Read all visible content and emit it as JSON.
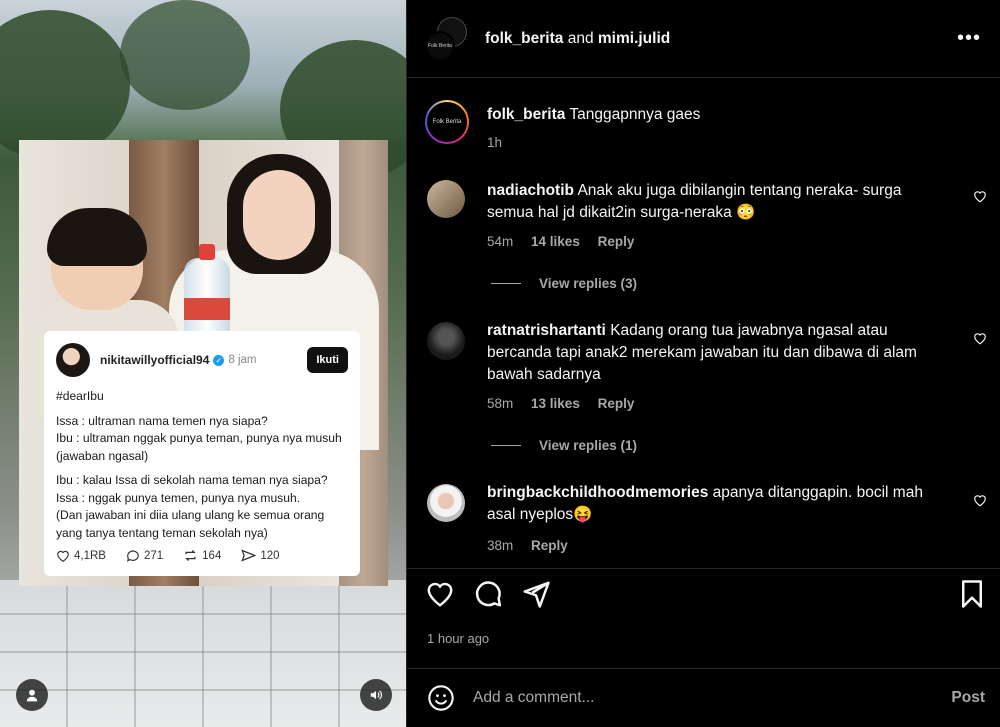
{
  "header": {
    "user1": "folk_berita",
    "joiner": "and",
    "user2": "mimi.julid",
    "avatar2_text": "Folk Berita",
    "more_icon": "more-horizontal-icon"
  },
  "caption": {
    "username": "folk_berita",
    "text": "Tanggapnnya gaes",
    "time": "1h",
    "avatar_text": "Folk Berita"
  },
  "comments": [
    {
      "username": "nadiachotib",
      "text": "Anak aku juga dibilangin tentang neraka- surga semua hal jd dikait2in surga-neraka 😳",
      "time": "54m",
      "likes": "14 likes",
      "reply": "Reply",
      "view_replies": "View replies (3)"
    },
    {
      "username": "ratnatrishartanti",
      "text": "Kadang orang tua jawabnya ngasal atau bercanda tapi anak2 merekam jawaban itu dan dibawa di alam bawah sadarnya",
      "time": "58m",
      "likes": "13 likes",
      "reply": "Reply",
      "view_replies": "View replies (1)"
    },
    {
      "username": "bringbackchildhoodmemories",
      "text": "apanya ditanggapin. bocil mah asal nyeplos😝",
      "time": "38m",
      "reply": "Reply"
    }
  ],
  "actions": {
    "like_icon": "heart-icon",
    "comment_icon": "comment-icon",
    "share_icon": "paper-plane-icon",
    "save_icon": "bookmark-icon",
    "time_ago": "1 hour ago"
  },
  "composer": {
    "placeholder": "Add a comment...",
    "post_label": "Post",
    "emoji_icon": "smiley-icon"
  },
  "media": {
    "tweet": {
      "username": "nikitawillyofficial94",
      "time": "8 jam",
      "follow_label": "Ikuti",
      "hashtag": "#dearIbu",
      "para1": "Issa : ultraman nama temen nya siapa?\nIbu : ultraman nggak punya teman, punya nya musuh (jawaban ngasal)",
      "para2": "Ibu : kalau Issa di sekolah nama teman nya siapa?\nIssa : nggak punya temen, punya nya musuh.\n(Dan jawaban ini diia ulang ulang ke semua orang yang tanya tentang teman sekolah nya)",
      "likes": "4,1RB",
      "replies": "271",
      "reposts": "164",
      "shares": "120"
    },
    "user_icon": "user-tag-icon",
    "volume_icon": "volume-icon"
  }
}
